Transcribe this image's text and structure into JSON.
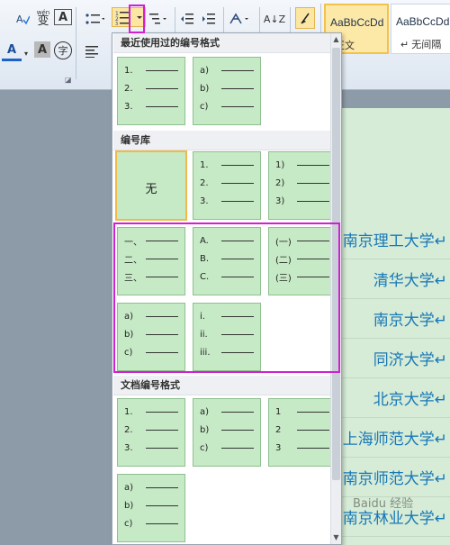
{
  "ribbon": {
    "buttons": {
      "pinyin_icon": "wén",
      "pinyin_char": "变",
      "char_border": "A",
      "font_color": "A",
      "char_shade": "A",
      "enclose_char": "字",
      "sort": "A↓Z"
    },
    "styles": [
      {
        "sample": "AaBbCcDd",
        "caption": "正文",
        "selected": true
      },
      {
        "sample": "AaBbCcDd",
        "caption": "↵ 无间隔",
        "selected": false
      }
    ]
  },
  "dropdown": {
    "sections": {
      "recent": "最近使用过的编号格式",
      "library": "编号库",
      "document": "文档编号格式"
    },
    "none_label": "无",
    "recent_tiles": [
      [
        "1.",
        "2.",
        "3."
      ],
      [
        "a)",
        "b)",
        "c)"
      ]
    ],
    "library_tiles": [
      [
        "1.",
        "2.",
        "3."
      ],
      [
        "1)",
        "2)",
        "3)"
      ],
      [
        "一、",
        "二、",
        "三、"
      ],
      [
        "A.",
        "B.",
        "C."
      ],
      [
        "(一)",
        "(二)",
        "(三)"
      ],
      [
        "a)",
        "b)",
        "c)"
      ],
      [
        "i.",
        "ii.",
        "iii."
      ]
    ],
    "document_tiles": [
      [
        "1.",
        "2.",
        "3."
      ],
      [
        "a)",
        "b)",
        "c)"
      ],
      [
        "1",
        "2",
        "3"
      ],
      [
        "a)",
        "b)",
        "c)"
      ]
    ]
  },
  "document": {
    "lines": [
      "南京理工大学↵",
      "清华大学↵",
      "南京大学↵",
      "同济大学↵",
      "北京大学↵",
      "上海师范大学↵",
      "南京师范大学↵",
      "南京林业大学↵"
    ]
  },
  "watermark": "Baidu 经验"
}
